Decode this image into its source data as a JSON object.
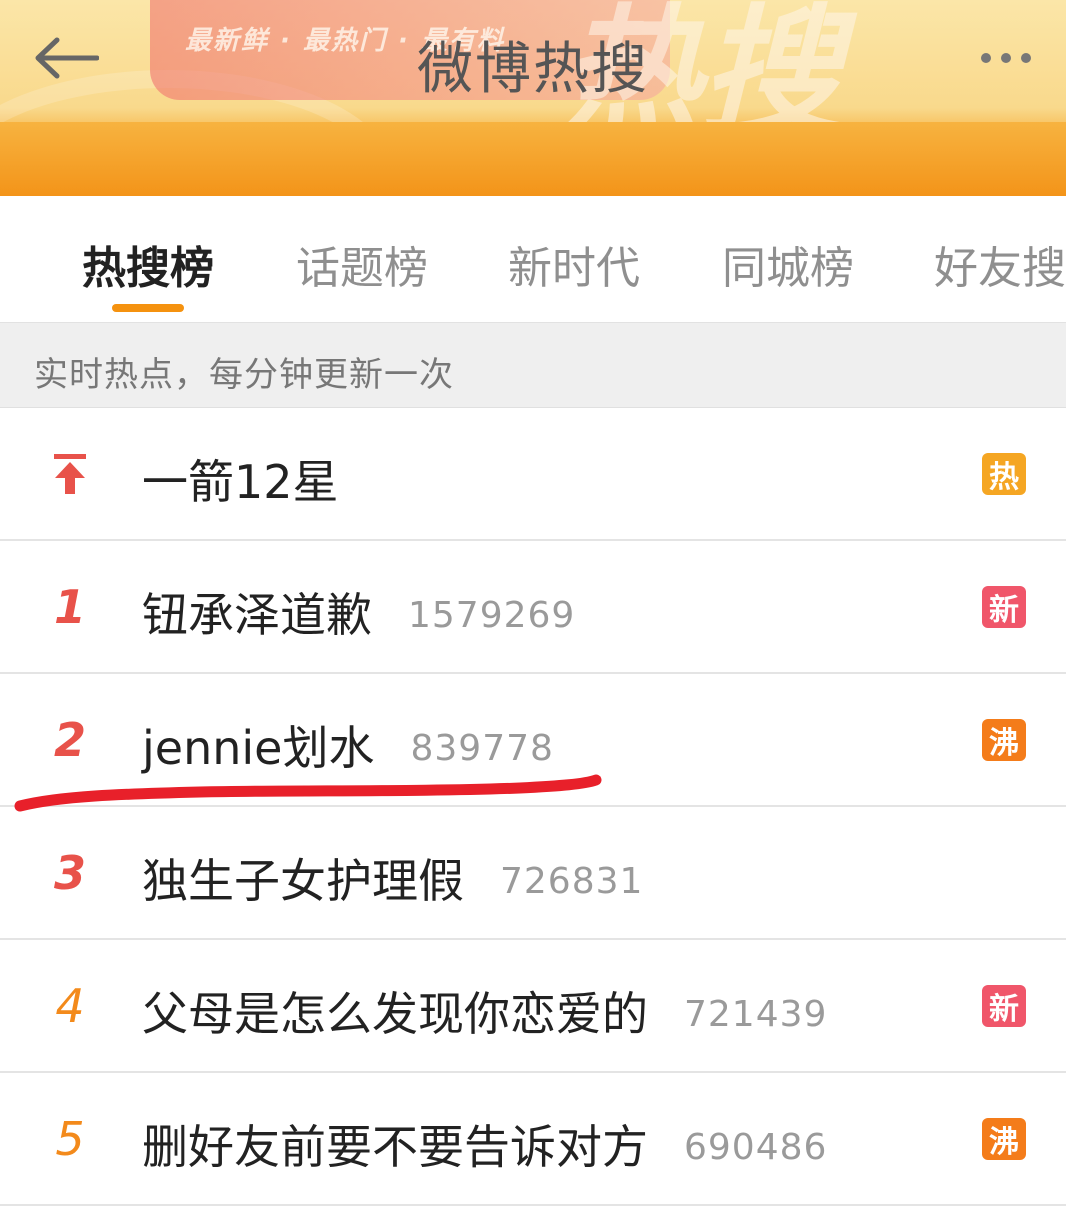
{
  "header": {
    "title": "微博热搜",
    "banner_text": "最新鲜 · 最热门 · 最有料",
    "colors": {
      "banner_top": "#fbe6a8",
      "banner_bottom": "#f39a1f"
    }
  },
  "tabs": [
    {
      "label": "热搜榜",
      "active": true
    },
    {
      "label": "话题榜",
      "active": false
    },
    {
      "label": "新时代",
      "active": false
    },
    {
      "label": "同城榜",
      "active": false
    },
    {
      "label": "好友搜",
      "active": false
    }
  ],
  "notice": "实时热点，每分钟更新一次",
  "items": [
    {
      "rank": "",
      "rank_icon": "pinned-arrow-up-icon",
      "title": "一箭12星",
      "count": "",
      "badge": "热",
      "badge_type": "hot"
    },
    {
      "rank": "1",
      "title": "钮承泽道歉",
      "count": "1579269",
      "badge": "新",
      "badge_type": "new"
    },
    {
      "rank": "2",
      "title": "jennie划水",
      "count": "839778",
      "badge": "沸",
      "badge_type": "boil"
    },
    {
      "rank": "3",
      "title": "独生子女护理假",
      "count": "726831",
      "badge": "",
      "badge_type": ""
    },
    {
      "rank": "4",
      "title": "父母是怎么发现你恋爱的",
      "count": "721439",
      "badge": "新",
      "badge_type": "new"
    },
    {
      "rank": "5",
      "title": "删好友前要不要告诉对方",
      "count": "690486",
      "badge": "沸",
      "badge_type": "boil"
    }
  ],
  "annotation": {
    "type": "red-hand-drawn-underline",
    "color": "#e8202a"
  }
}
